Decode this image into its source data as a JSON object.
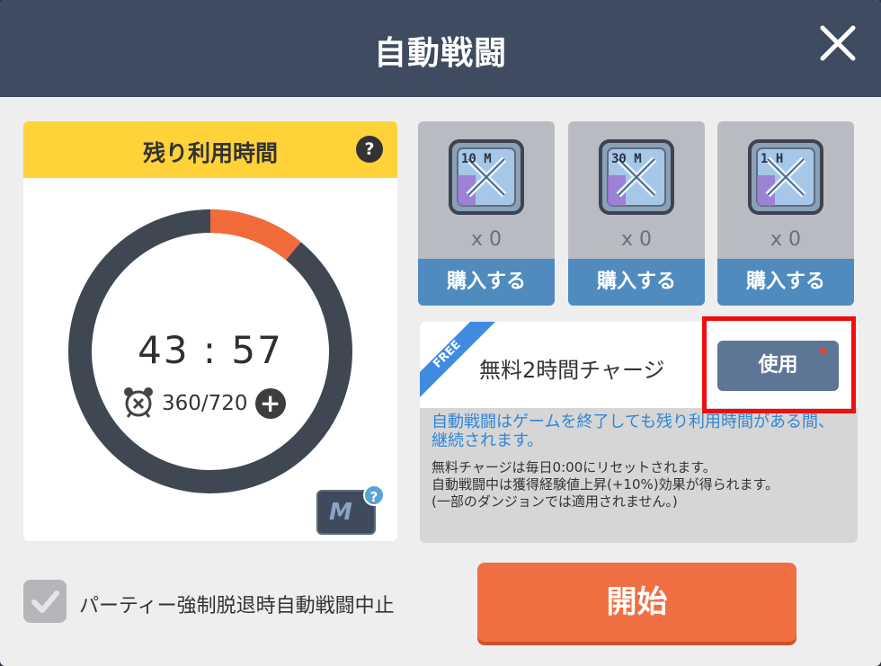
{
  "header": {
    "title": "自動戦闘"
  },
  "timer": {
    "label": "残り利用時間",
    "help": "?",
    "time": "43 : 57",
    "count": "360/720",
    "remaining_fraction": 0.11
  },
  "items": [
    {
      "icon_text": "10 M",
      "qty": "x 0",
      "buy_label": "購入する"
    },
    {
      "icon_text": "30 M",
      "qty": "x 0",
      "buy_label": "購入する"
    },
    {
      "icon_text": "1 H",
      "qty": "x 0",
      "buy_label": "購入する"
    }
  ],
  "free_charge": {
    "ribbon": "FREE",
    "label": "無料2時間チャージ",
    "use_label": "使用",
    "info_blue": "自動戦闘はゲームを終了しても残り利用時間がある間、継続されます。",
    "info_lines": [
      "無料チャージは毎日0:00にリセットされます。",
      "自動戦闘中は獲得経験値上昇(+10%)効果が得られます。",
      "(一部のダンジョンでは適用されません。)"
    ]
  },
  "footer": {
    "checkbox_label": "パーティー強制脱退時自動戦闘中止",
    "checkbox_checked": true,
    "start_label": "開始"
  },
  "colors": {
    "header": "#3e4b61",
    "yellow": "#ffd23a",
    "ring_track": "#3f4753",
    "ring_progress": "#f26b3a",
    "buy": "#4f8bbf",
    "start": "#ef6f42",
    "info_blue": "#2f86d6"
  },
  "icons": {
    "close": "close-icon",
    "alarm": "alarm-clock-icon",
    "plus": "plus-icon",
    "check": "check-icon",
    "item": "crossed-swords-ticket-icon"
  },
  "m_badge": {
    "letter": "M",
    "help": "?"
  }
}
